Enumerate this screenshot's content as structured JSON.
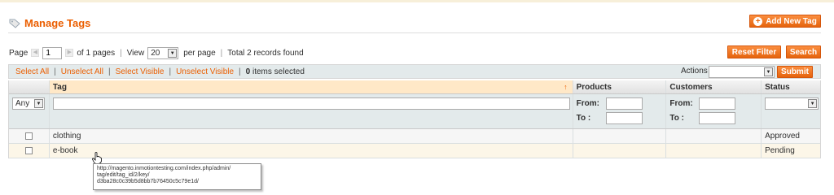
{
  "header": {
    "title": "Manage Tags",
    "add_button_label": "Add New Tag"
  },
  "pager": {
    "page_label": "Page",
    "current_page": "1",
    "of_pages": "of 1 pages",
    "view_label": "View",
    "per_page_value": "20",
    "per_page_label": "per page",
    "records_found": "Total 2 records found"
  },
  "buttons": {
    "reset_filter": "Reset Filter",
    "search": "Search",
    "submit": "Submit"
  },
  "massaction": {
    "select_all": "Select All",
    "unselect_all": "Unselect All",
    "select_visible": "Select Visible",
    "unselect_visible": "Unselect Visible",
    "items_selected_count": "0",
    "items_selected_label": "items selected",
    "actions_label": "Actions",
    "actions_value": ""
  },
  "grid": {
    "columns": {
      "tag": "Tag",
      "products": "Products",
      "customers": "Customers",
      "status": "Status"
    },
    "filter": {
      "massaction_select": "Any",
      "tag_value": "",
      "from_label": "From:",
      "to_label": "To :",
      "status_value": ""
    },
    "rows": [
      {
        "tag": "clothing",
        "products": "",
        "customers": "",
        "status": "Approved"
      },
      {
        "tag": "e-book",
        "products": "",
        "customers": "",
        "status": "Pending"
      }
    ]
  },
  "tooltip": {
    "line1": "http://magento.inmotiontesting.com/index.php/admin/",
    "line2": "tag/edit/tag_id/2/key/",
    "line3": "d3ba28c0c39b5d8bb7b76450c5c79e1d/"
  },
  "colors": {
    "accent": "#eb5e00",
    "button": "#f07b24",
    "grid_filter_bg": "#e3eaeb"
  }
}
